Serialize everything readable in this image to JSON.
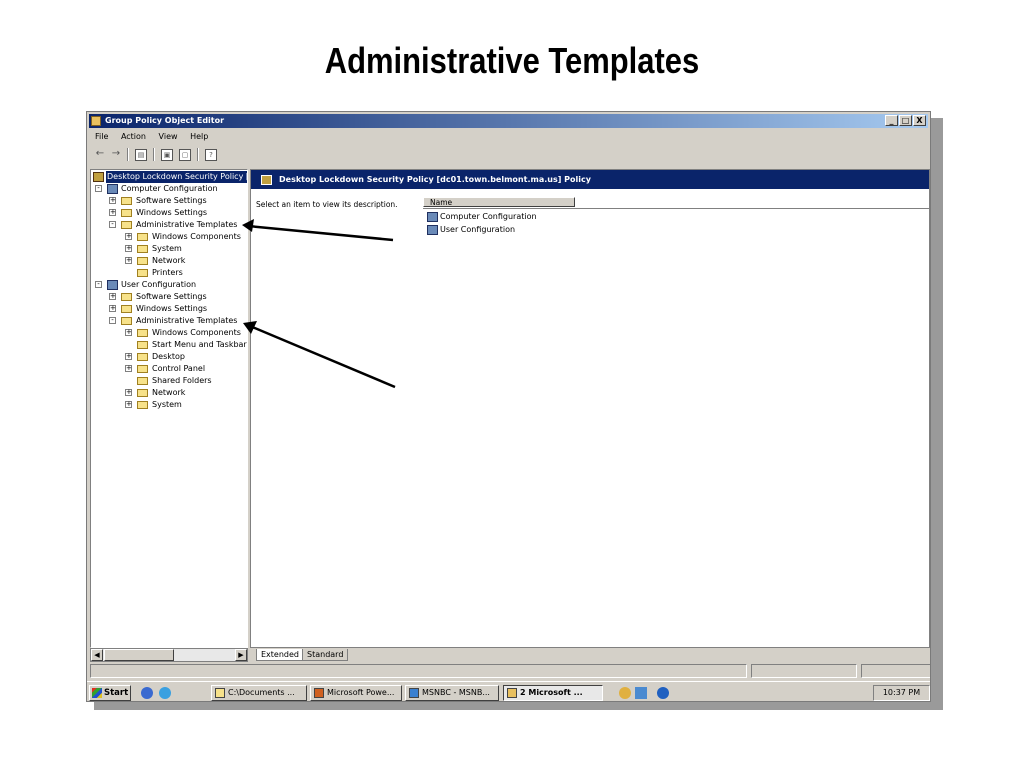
{
  "slide": {
    "title": "Administrative Templates"
  },
  "window": {
    "title": "Group Policy Object Editor",
    "controls": {
      "minimize": "_",
      "maximize": "□",
      "close": "X"
    }
  },
  "menu": {
    "items": [
      "File",
      "Action",
      "View",
      "Help"
    ]
  },
  "tree": {
    "items": [
      {
        "label": "Desktop Lockdown Security Policy [d",
        "icon": "policy-icon"
      },
      {
        "label": "Computer Configuration",
        "icon": "computer-icon"
      },
      {
        "label": "Software Settings",
        "icon": "folder-icon"
      },
      {
        "label": "Windows Settings",
        "icon": "folder-icon"
      },
      {
        "label": "Administrative Templates",
        "icon": "folder-icon"
      },
      {
        "label": "Windows Components",
        "icon": "folder-icon"
      },
      {
        "label": "System",
        "icon": "folder-icon"
      },
      {
        "label": "Network",
        "icon": "folder-icon"
      },
      {
        "label": "Printers",
        "icon": "folder-icon"
      },
      {
        "label": "User Configuration",
        "icon": "user-icon"
      },
      {
        "label": "Software Settings",
        "icon": "folder-icon"
      },
      {
        "label": "Windows Settings",
        "icon": "folder-icon"
      },
      {
        "label": "Administrative Templates",
        "icon": "folder-icon"
      },
      {
        "label": "Windows Components",
        "icon": "folder-icon"
      },
      {
        "label": "Start Menu and Taskbar",
        "icon": "folder-icon"
      },
      {
        "label": "Desktop",
        "icon": "folder-icon"
      },
      {
        "label": "Control Panel",
        "icon": "folder-icon"
      },
      {
        "label": "Shared Folders",
        "icon": "folder-icon"
      },
      {
        "label": "Network",
        "icon": "folder-icon"
      },
      {
        "label": "System",
        "icon": "folder-icon"
      }
    ]
  },
  "details": {
    "header": "Desktop Lockdown Security Policy [dc01.town.belmont.ma.us] Policy",
    "description": "Select an item to view its description.",
    "column": "Name",
    "items": [
      "Computer Configuration",
      "User Configuration"
    ]
  },
  "tabs": [
    "Extended",
    "Standard"
  ],
  "taskbar": {
    "start": "Start",
    "tasks": [
      "C:\\Documents ...",
      "Microsoft Powe...",
      "MSNBC - MSNB...",
      "2 Microsoft ..."
    ],
    "clock": "10:37 PM"
  },
  "colors": {
    "titlebar": "#0a246a",
    "chrome": "#d4d0c8",
    "selection": "#0a246a"
  }
}
